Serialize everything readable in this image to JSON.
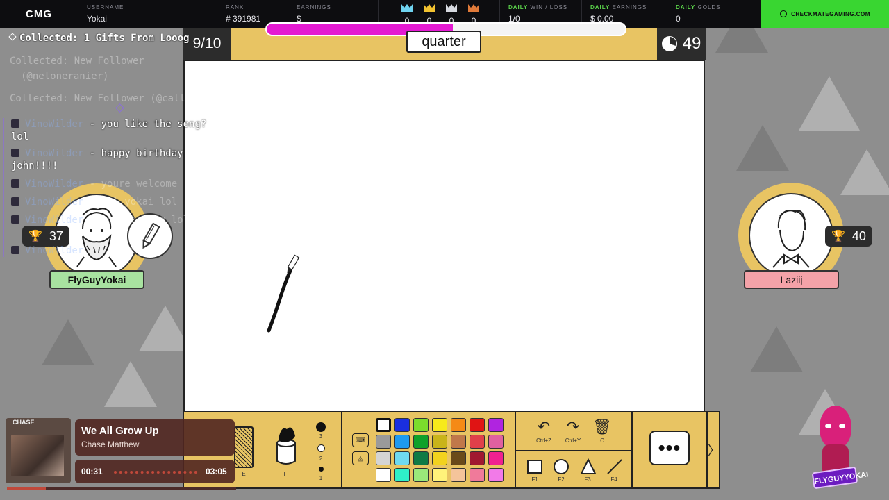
{
  "topbar": {
    "logo": "CMG",
    "username_label": "USERNAME",
    "username": "Yokai",
    "rank_label": "RANK",
    "rank": "# 391981",
    "earnings_label": "EARNINGS",
    "earnings": "$",
    "crowns": [
      {
        "color": "#6fd3f0",
        "count": "0"
      },
      {
        "color": "#f2c230",
        "count": "0"
      },
      {
        "color": "#d6d9e0",
        "count": "0"
      },
      {
        "color": "#e07a3a",
        "count": "0"
      }
    ],
    "daily_winloss_prefix": "DAILY",
    "daily_winloss_label": "WIN / LOSS",
    "daily_winloss": "1/0",
    "daily_earnings_prefix": "DAILY",
    "daily_earnings_label": "EARNINGS",
    "daily_earnings": "$ 0.00",
    "daily_golds_prefix": "DAILY",
    "daily_golds_label": "GOLDS",
    "daily_golds": "0",
    "cta": "CHECKMATEGAMING.COM"
  },
  "game": {
    "round": "9/10",
    "word": "quarter",
    "timer": "49",
    "timer_remaining_fraction": 0.7,
    "hint_bar_fraction": 0.52,
    "stroke_color": "#111111"
  },
  "players": {
    "left": {
      "name": "FlyGuyYokai",
      "score": "37",
      "name_bg": "#a8e2a0",
      "is_drawing": true
    },
    "right": {
      "name": "Laziij",
      "score": "40",
      "name_bg": "#f4a2a8"
    }
  },
  "chat": {
    "collected": "Collected: 1 Gifts From Looog",
    "faded_lines": [
      "Collected: New Follower",
      "(@neloneranier)",
      "Collected: New Follower (@callan15)"
    ],
    "messages": [
      {
        "name": "VinoWilder",
        "text": "- you like the song? lol"
      },
      {
        "name": "VinoWilder",
        "text": "- happy birthday john!!!!"
      },
      {
        "name": "VinoWilder",
        "text": "- youre welcome"
      },
      {
        "name": "VinoWilder",
        "text": "- oml yokai lol"
      },
      {
        "name": "VinoWilder",
        "text": "- this boring lol"
      },
      {
        "name": "VinoWilder",
        "text": "- laziing af"
      }
    ]
  },
  "toolbar": {
    "brush_labels": [
      "E",
      "F"
    ],
    "sizes": [
      "3",
      "2",
      "1"
    ],
    "colors": [
      [
        "#ffffff",
        "#1a2fe0",
        "#7bdd2c",
        "#f7ea1b",
        "#f58a16",
        "#e01414",
        "#b024e0"
      ],
      [
        "#9a9a9a",
        "#1f9af0",
        "#0fa12a",
        "#c9b41a",
        "#c0784a",
        "#e0404a",
        "#e060a0"
      ],
      [
        "#d4d4d4",
        "#6fdaf0",
        "#0f7a45",
        "#f2d21e",
        "#6a4a1a",
        "#a01830",
        "#f02090"
      ],
      [
        "#ffffff",
        "#2ff0c8",
        "#9ae87a",
        "#fff27a",
        "#f4c49a",
        "#f07a9a",
        "#f27ae8"
      ]
    ],
    "undo_label": "Ctrl+Z",
    "redo_label": "Ctrl+Y",
    "clear_label": "C",
    "shape_labels": [
      "F1",
      "F2",
      "F3",
      "F4"
    ]
  },
  "music": {
    "album_label": "CHASE",
    "title": "We All Grow Up",
    "artist": "Chase Matthew",
    "elapsed": "00:31",
    "total": "03:05",
    "progress_fraction": 0.17
  },
  "mascot": {
    "logo_text": "FLYGUYYOKAI"
  }
}
